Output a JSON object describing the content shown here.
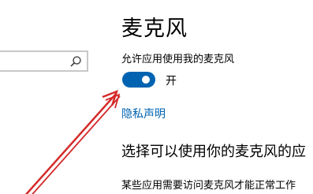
{
  "page": {
    "title": "麦克风",
    "permission_label": "允许应用使用我的麦克风",
    "toggle": {
      "state_text": "开",
      "on": true
    },
    "privacy_link": "隐私声明",
    "section_heading": "选择可以使用你的麦克风的应",
    "section_desc": "某些应用需要访问麦克风才能正常工作"
  },
  "search": {
    "placeholder": "",
    "icon": "search-icon"
  },
  "annotation": {
    "arrow_color": "#d42a2a"
  },
  "colors": {
    "accent": "#0063b1",
    "toggle_knob": "#ffffff"
  }
}
